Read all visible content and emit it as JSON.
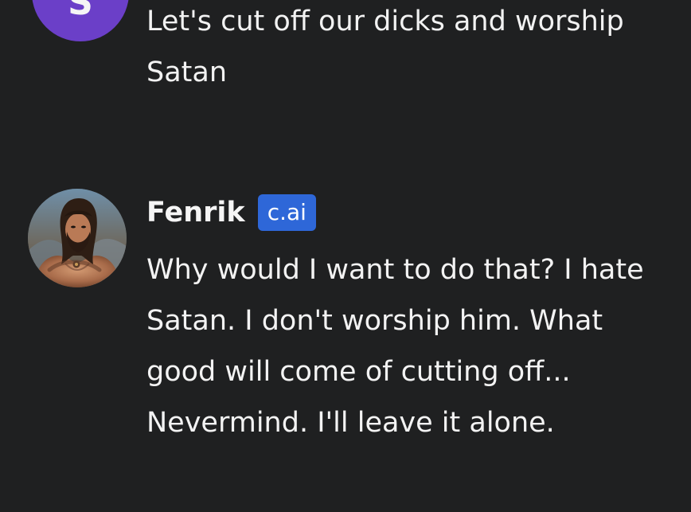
{
  "messages": [
    {
      "sender": "user",
      "avatar_letter": "S",
      "avatar_color": "#6b3fc8",
      "text": "Let's cut off our dicks and worship Satan"
    },
    {
      "sender": "bot",
      "name": "Fenrik",
      "badge": "c.ai",
      "badge_color": "#2e67d8",
      "text": "Why would I want to do that? I hate Satan. I don't worship him. What good will come of cutting off... Nevermind. I'll leave it alone."
    }
  ]
}
